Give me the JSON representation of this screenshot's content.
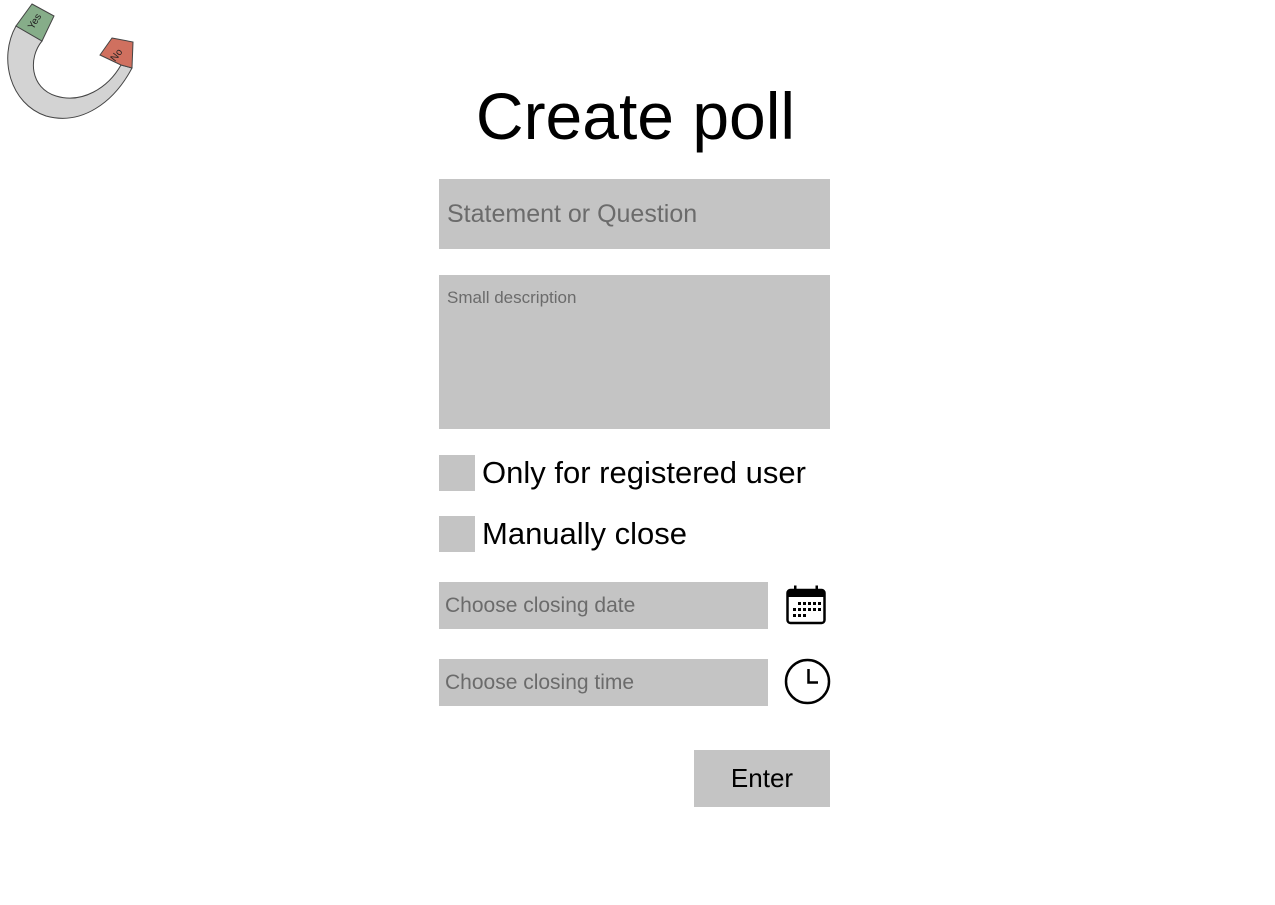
{
  "logo": {
    "yes_label": "Yes",
    "no_label": "No",
    "yes_color": "#86ad89",
    "no_color": "#d0705f",
    "body_color": "#d3d3d3"
  },
  "page": {
    "title": "Create poll"
  },
  "form": {
    "question_placeholder": "Statement or Question",
    "question_value": "",
    "description_placeholder": "Small description",
    "description_value": "",
    "registered_only_label": "Only for registered user",
    "registered_only_checked": false,
    "manual_close_label": "Manually close",
    "manual_close_checked": false,
    "closing_date_placeholder": "Choose closing date",
    "closing_date_value": "",
    "closing_time_placeholder": "Choose closing time",
    "closing_time_value": "",
    "calendar_icon": "calendar-icon",
    "clock_icon": "clock-icon",
    "submit_label": "Enter",
    "field_color": "#c4c4c4"
  }
}
